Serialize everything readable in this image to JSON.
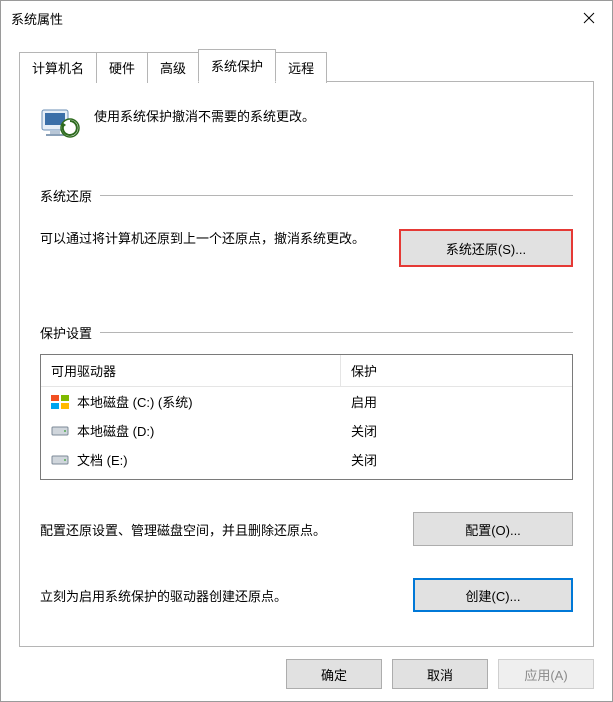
{
  "window": {
    "title": "系统属性"
  },
  "tabs": {
    "computer_name": "计算机名",
    "hardware": "硬件",
    "advanced": "高级",
    "system_protection": "系统保护",
    "remote": "远程",
    "active": "system_protection"
  },
  "intro_text": "使用系统保护撤消不需要的系统更改。",
  "sections": {
    "restore_title": "系统还原",
    "restore_text": "可以通过将计算机还原到上一个还原点，撤消系统更改。",
    "restore_button": "系统还原(S)...",
    "settings_title": "保护设置",
    "config_text": "配置还原设置、管理磁盘空间，并且删除还原点。",
    "config_button": "配置(O)...",
    "create_text": "立刻为启用系统保护的驱动器创建还原点。",
    "create_button": "创建(C)..."
  },
  "drive_table": {
    "headers": {
      "drive": "可用驱动器",
      "protection": "保护"
    },
    "rows": [
      {
        "icon": "windows",
        "name": "本地磁盘 (C:) (系统)",
        "protection": "启用"
      },
      {
        "icon": "disk",
        "name": "本地磁盘 (D:)",
        "protection": "关闭"
      },
      {
        "icon": "disk",
        "name": "文档 (E:)",
        "protection": "关闭"
      }
    ]
  },
  "footer": {
    "ok": "确定",
    "cancel": "取消",
    "apply": "应用(A)"
  }
}
